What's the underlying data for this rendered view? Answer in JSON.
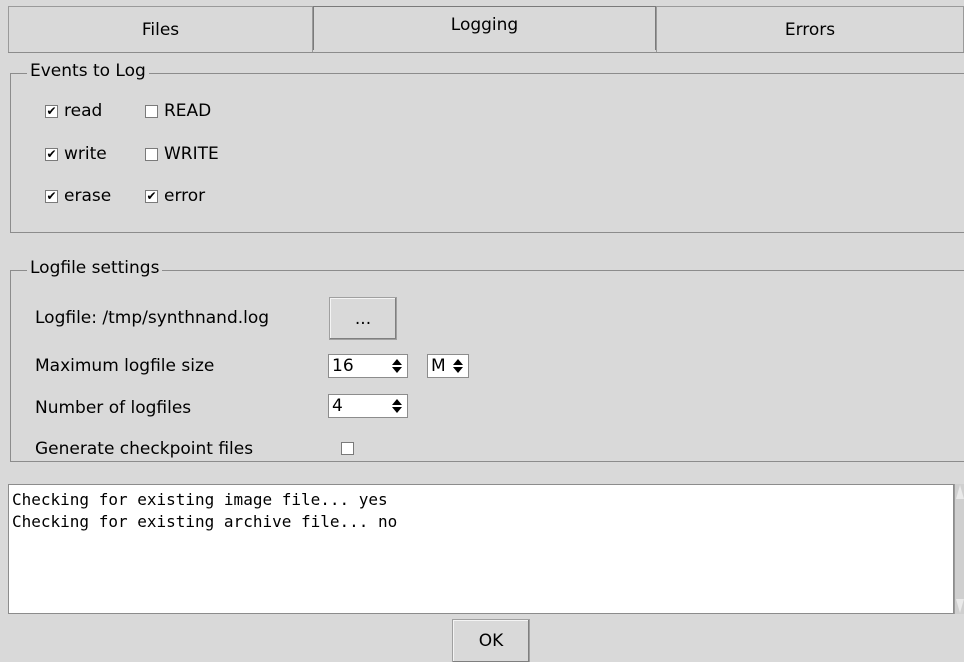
{
  "tabs": [
    {
      "label": "Files"
    },
    {
      "label": "Logging"
    },
    {
      "label": "Errors"
    }
  ],
  "events_group": {
    "title": "Events to Log",
    "items": [
      {
        "label": "read",
        "checked": true
      },
      {
        "label": "READ",
        "checked": false
      },
      {
        "label": "write",
        "checked": true
      },
      {
        "label": "WRITE",
        "checked": false
      },
      {
        "label": "erase",
        "checked": true
      },
      {
        "label": "error",
        "checked": true
      }
    ]
  },
  "logfile_group": {
    "title": "Logfile settings",
    "logfile_label": "Logfile: /tmp/synthnand.log",
    "browse_label": "...",
    "max_size_label": "Maximum logfile size",
    "max_size_value": "16",
    "max_size_unit": "M",
    "num_files_label": "Number of logfiles",
    "num_files_value": "4",
    "checkpoint_label": "Generate checkpoint files",
    "checkpoint_checked": false
  },
  "log_output": {
    "lines": [
      "Checking for existing image file... yes",
      "Checking for existing archive file... no"
    ]
  },
  "footer": {
    "ok_label": "OK"
  }
}
